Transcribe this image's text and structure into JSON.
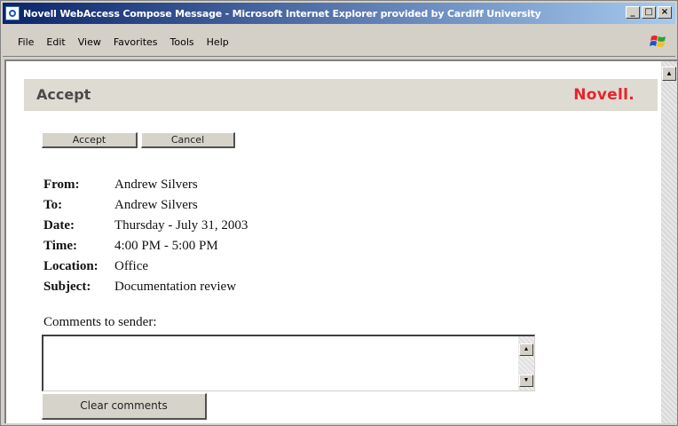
{
  "window": {
    "title": "Novell WebAccess Compose Message - Microsoft Internet Explorer provided by Cardiff University",
    "controls": {
      "minimize": "_",
      "maximize": "□",
      "close": "×"
    }
  },
  "menu": {
    "items": [
      "File",
      "Edit",
      "View",
      "Favorites",
      "Tools",
      "Help"
    ]
  },
  "page": {
    "title": "Accept",
    "brand": "Novell."
  },
  "buttons": {
    "accept": "Accept",
    "cancel": "Cancel",
    "clear": "Clear comments"
  },
  "fields": [
    {
      "label": "From:",
      "value": "Andrew Silvers"
    },
    {
      "label": "To:",
      "value": "Andrew Silvers"
    },
    {
      "label": "Date:",
      "value": "Thursday - July 31, 2003"
    },
    {
      "label": "Time:",
      "value": "4:00 PM - 5:00 PM"
    },
    {
      "label": "Location:",
      "value": "Office"
    },
    {
      "label": "Subject:",
      "value": "Documentation review"
    }
  ],
  "comments": {
    "label": "Comments to sender:",
    "value": ""
  },
  "icons": {
    "app": "ie-page-icon",
    "throbber": "windows-flag-icon"
  },
  "colors": {
    "brand": "#e8242a",
    "header_band": "#dedbd3",
    "titlebar_start": "#0a246a"
  }
}
